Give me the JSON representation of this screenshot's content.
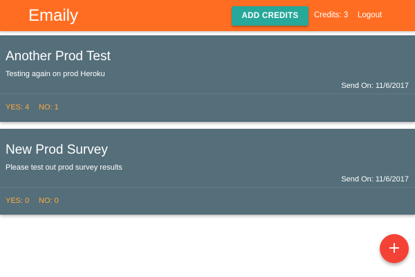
{
  "header": {
    "brand": "Emaily",
    "add_credits_label": "ADD CREDITS",
    "credits_text": "Credits: 3",
    "logout_label": "Logout"
  },
  "surveys": [
    {
      "title": "Another Prod Test",
      "body": "Testing again on prod Heroku",
      "sent_on": "Send On: 11/6/2017",
      "yes": "YES: 4",
      "no": "NO: 1"
    },
    {
      "title": "New Prod Survey",
      "body": "Please test out prod survey results",
      "sent_on": "Send On: 11/6/2017",
      "yes": "YES: 0",
      "no": "NO: 0"
    }
  ],
  "fab": {
    "icon": "plus-icon",
    "glyph": "+"
  },
  "colors": {
    "header_bg": "#ff6d22",
    "button_bg": "#27a89a",
    "card_bg": "#546e7a",
    "stat_text": "#ffab40",
    "fab_bg": "#f44336"
  }
}
